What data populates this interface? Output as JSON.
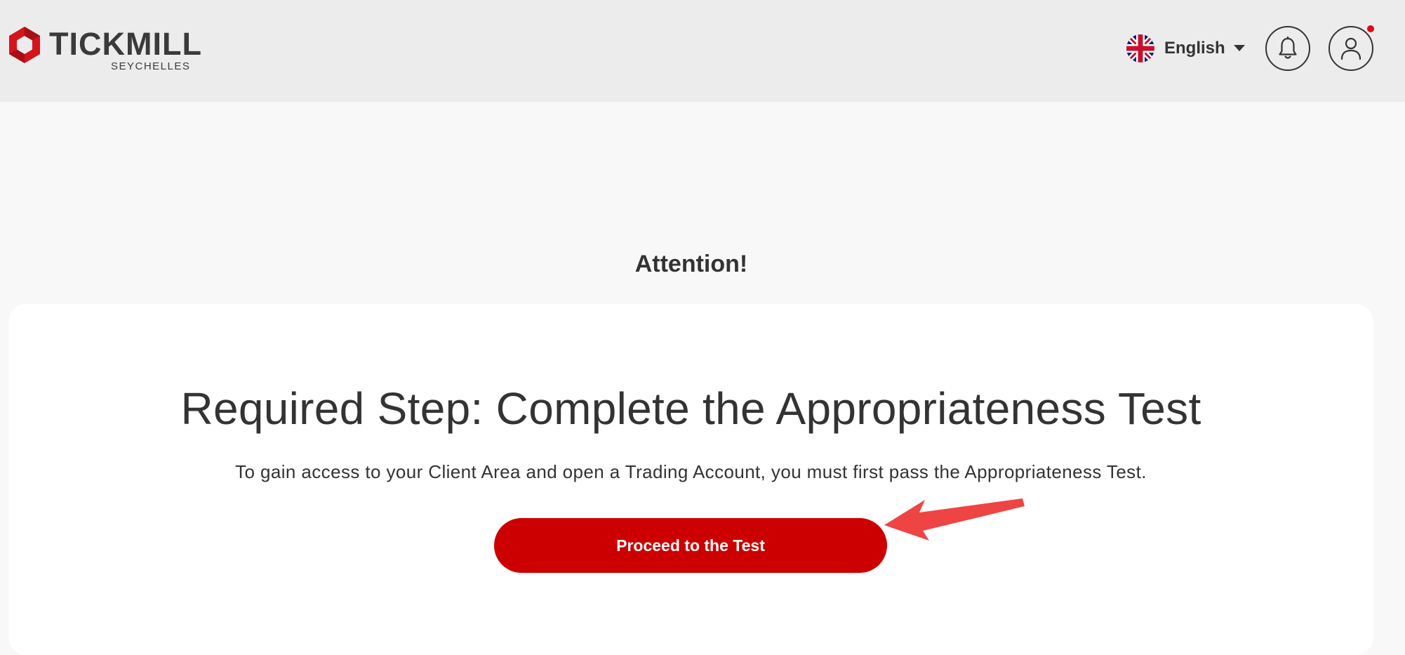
{
  "header": {
    "logo": {
      "wordmark": "TICKMILL",
      "region": "SEYCHELLES",
      "brand_color": "#d5141c"
    },
    "language": {
      "selected": "English",
      "flag_icon": "uk-flag-icon",
      "caret_icon": "caret-down-icon"
    },
    "notifications_icon": "bell-icon",
    "profile_icon": "user-icon",
    "notification_dot_color": "#e30613"
  },
  "main": {
    "heading": "Attention!",
    "card": {
      "title": "Required Step: Complete the Appropriateness Test",
      "description": "To gain access to your Client Area and open a Trading Account, you must first pass the Appropriateness Test.",
      "button_label": "Proceed to the Test",
      "button_color": "#cc0000"
    },
    "annotation_arrow_color": "#ef4444"
  }
}
